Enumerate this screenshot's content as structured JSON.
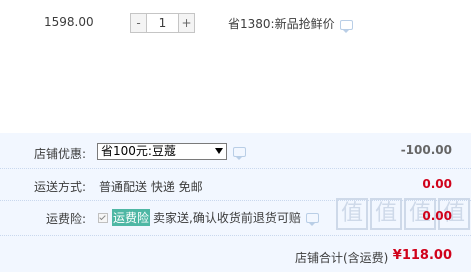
{
  "item": {
    "price": "1598.00",
    "quantity": "1",
    "decrement_label": "-",
    "increment_label": "+",
    "promotion": "省1380:新品抢鲜价"
  },
  "shop_discount": {
    "label": "店铺优惠:",
    "selected": "省100元:豆蔻",
    "amount": "-100.00"
  },
  "shipping": {
    "label": "运送方式:",
    "value": "普通配送 快递 免邮",
    "amount": "0.00"
  },
  "insurance": {
    "label": "运费险:",
    "tag": "运费险",
    "description": "卖家送,确认收货前退货可赔",
    "amount": "0.00",
    "checked": true
  },
  "total": {
    "label": "店铺合计(含运费)",
    "amount": "¥118.00"
  },
  "watermark": {
    "glyph": "值"
  }
}
